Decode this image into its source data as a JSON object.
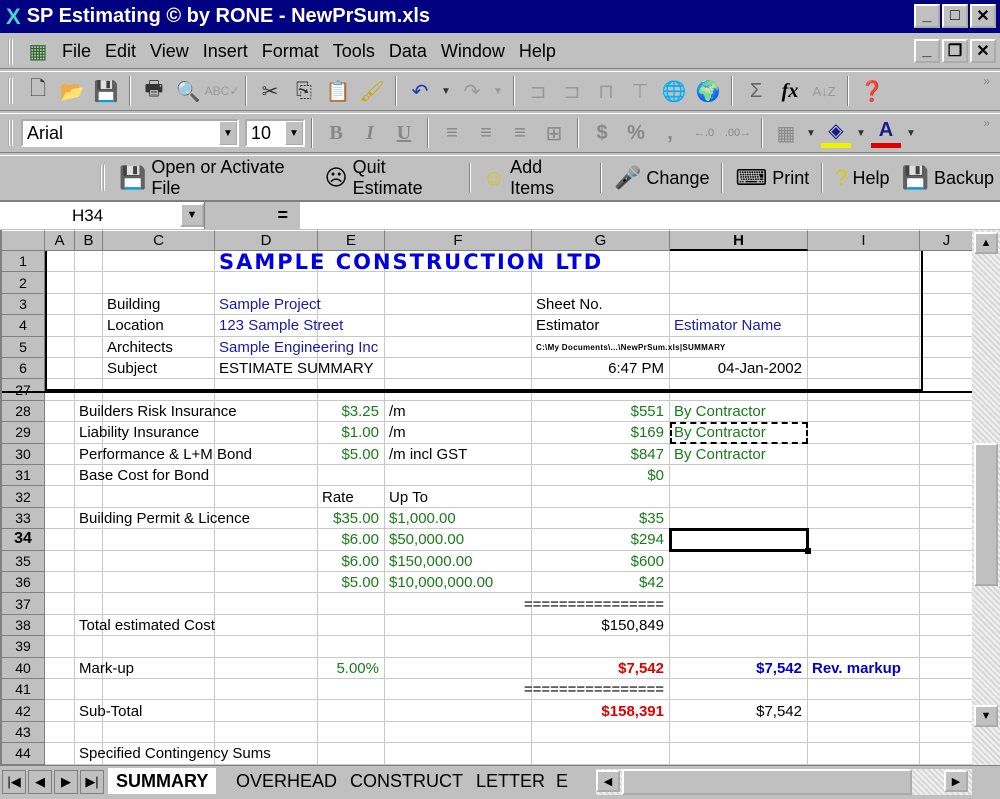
{
  "window": {
    "title": "SP Estimating © by RONE - NewPrSum.xls",
    "controls": [
      "_",
      "□",
      "✕"
    ],
    "doc_controls": [
      "_",
      "❐",
      "✕"
    ]
  },
  "menu": {
    "items": [
      {
        "label": "File",
        "accel": "F"
      },
      {
        "label": "Edit",
        "accel": "E"
      },
      {
        "label": "View",
        "accel": "V"
      },
      {
        "label": "Insert",
        "accel": "I"
      },
      {
        "label": "Format",
        "accel": "o"
      },
      {
        "label": "Tools",
        "accel": "T"
      },
      {
        "label": "Data",
        "accel": "D"
      },
      {
        "label": "Window",
        "accel": "W"
      },
      {
        "label": "Help",
        "accel": "H"
      }
    ]
  },
  "standard_toolbar": {
    "icons": [
      "new-icon",
      "open-icon",
      "save-icon",
      "print-icon",
      "print-preview-icon",
      "spelling-icon",
      "cut-icon",
      "copy-icon",
      "paste-icon",
      "format-painter-icon",
      "undo-icon",
      "redo-icon",
      "trace-precedents-icon",
      "trace-dependents-icon",
      "remove-arrows-icon",
      "trace-error-icon",
      "hyperlink-icon",
      "web-icon",
      "autosum-icon",
      "function-icon",
      "sort-ascending-icon",
      "office-assistant-icon"
    ]
  },
  "formatting_toolbar": {
    "font": "Arial",
    "size": "10",
    "bold": "B",
    "italic": "I",
    "underline": "U",
    "currency": "$",
    "percent": "%",
    "comma": ","
  },
  "custom_toolbar": {
    "buttons": [
      {
        "label": "Open or Activate File",
        "icon": "open-file-icon"
      },
      {
        "label": "Quit Estimate",
        "icon": "sad-face-icon"
      },
      {
        "label": "Add Items",
        "icon": "smiley-icon"
      },
      {
        "label": "Change",
        "icon": "microphone-icon"
      },
      {
        "label": "Print",
        "icon": "keyboard-icon"
      },
      {
        "label": "Help",
        "icon": "question-icon"
      },
      {
        "label": "Backup",
        "icon": "backup-disk-icon"
      }
    ]
  },
  "formula_bar": {
    "name_box": "H34",
    "equals": "=",
    "formula": ""
  },
  "columns": [
    "A",
    "B",
    "C",
    "D",
    "E",
    "F",
    "G",
    "H",
    "I",
    "J"
  ],
  "active_cell": "H34",
  "rows": [
    "1",
    "2",
    "3",
    "4",
    "5",
    "6",
    "27",
    "28",
    "29",
    "30",
    "31",
    "32",
    "33",
    "34",
    "35",
    "36",
    "37",
    "38",
    "39",
    "40",
    "41",
    "42",
    "43",
    "44"
  ],
  "header": {
    "company": "SAMPLE CONSTRUCTION LTD",
    "building_label": "Building",
    "building": "Sample Project",
    "location_label": "Location",
    "location": "123 Sample Street",
    "architects_label": "Architects",
    "architects": "Sample Engineering Inc",
    "subject_label": "Subject",
    "subject": "ESTIMATE SUMMARY",
    "sheet_no_label": "Sheet No.",
    "estimator_label": "Estimator",
    "estimator": "Estimator Name",
    "file_path": "C:\\My Documents\\...\\NewPrSum.xls|SUMMARY",
    "time": "6:47 PM",
    "date": "04-Jan-2002"
  },
  "body": {
    "r28": {
      "label": "Builders Risk Insurance",
      "rate": "$3.25",
      "unit": "/m",
      "amount": "$551",
      "note": "By Contractor"
    },
    "r29": {
      "label": "Liability Insurance",
      "rate": "$1.00",
      "unit": "/m",
      "amount": "$169",
      "note": "By Contractor"
    },
    "r30": {
      "label": "Performance & L+M Bond",
      "rate": "$5.00",
      "unit": "/m incl GST",
      "amount": "$847",
      "note": "By Contractor"
    },
    "r31": {
      "label": "Base Cost for Bond",
      "amount": "$0"
    },
    "r32": {
      "rate_hdr": "Rate",
      "upto_hdr": "Up To"
    },
    "r33": {
      "label": "Building Permit & Licence",
      "rate": "$35.00",
      "upto": "$1,000.00",
      "amount": "$35"
    },
    "r34": {
      "rate": "$6.00",
      "upto": "$50,000.00",
      "amount": "$294"
    },
    "r35": {
      "rate": "$6.00",
      "upto": "$150,000.00",
      "amount": "$600"
    },
    "r36": {
      "rate": "$5.00",
      "upto": "$10,000,000.00",
      "amount": "$42"
    },
    "r37": {
      "divider": "================"
    },
    "r38": {
      "label": "Total estimated Cost",
      "amount": "$150,849"
    },
    "r40": {
      "label": "Mark-up",
      "pct": "5.00%",
      "amount": "$7,542",
      "rev_amount": "$7,542",
      "rev_label": "Rev. markup"
    },
    "r41": {
      "divider": "================"
    },
    "r42": {
      "label": "Sub-Total",
      "amount": "$158,391",
      "h_amount": "$7,542"
    },
    "r44": {
      "label": "Specified Contingency Sums"
    }
  },
  "sheet_tabs": [
    "SUMMARY",
    "OVERHEAD",
    "CONSTRUCT",
    "LETTER",
    "E"
  ],
  "active_sheet": "SUMMARY"
}
